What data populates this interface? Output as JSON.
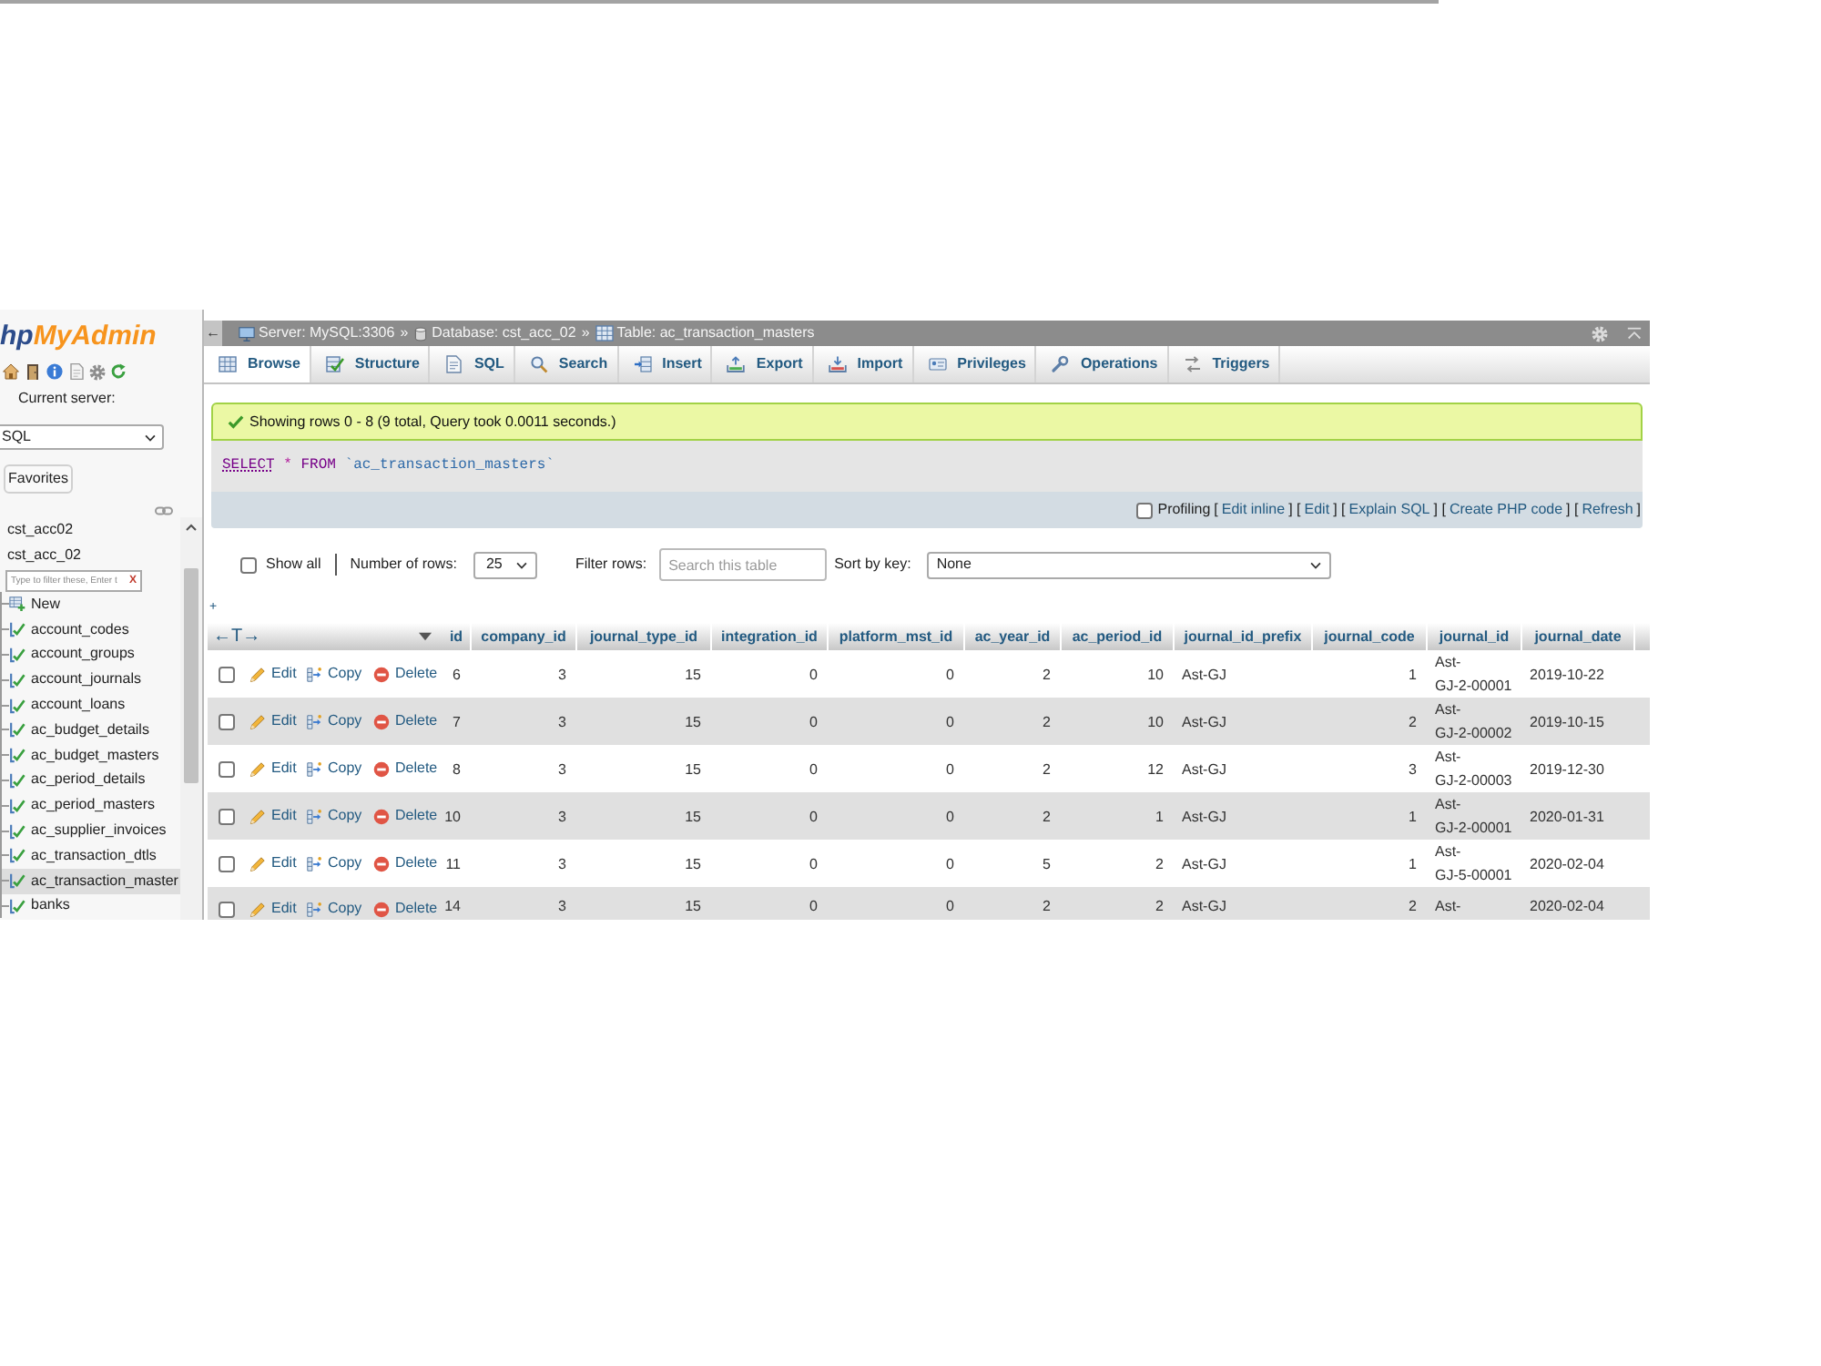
{
  "sidebar": {
    "logo": {
      "prefix": "hp",
      "name": "MyAdmin"
    },
    "current_server_label": "Current server:",
    "server_select": {
      "value": "SQL"
    },
    "favorites_button": "Favorites",
    "databases": [
      {
        "name": "cst_acc02",
        "selected": false
      },
      {
        "name": "cst_acc_02",
        "selected": false,
        "filter": {
          "placeholder": "Type to filter these, Enter t",
          "clear": "X"
        },
        "children": [
          {
            "kind": "new",
            "name": "New",
            "selected": false
          },
          {
            "kind": "table",
            "name": "account_codes",
            "selected": false
          },
          {
            "kind": "table",
            "name": "account_groups",
            "selected": false
          },
          {
            "kind": "table",
            "name": "account_journals",
            "selected": false
          },
          {
            "kind": "table",
            "name": "account_loans",
            "selected": false
          },
          {
            "kind": "table",
            "name": "ac_budget_details",
            "selected": false
          },
          {
            "kind": "table",
            "name": "ac_budget_masters",
            "selected": false
          },
          {
            "kind": "table",
            "name": "ac_period_details",
            "selected": false
          },
          {
            "kind": "table",
            "name": "ac_period_masters",
            "selected": false
          },
          {
            "kind": "table",
            "name": "ac_supplier_invoices",
            "selected": false
          },
          {
            "kind": "table",
            "name": "ac_transaction_dtls",
            "selected": false
          },
          {
            "kind": "table",
            "name": "ac_transaction_master",
            "selected": true
          },
          {
            "kind": "table",
            "name": "banks",
            "selected": false
          }
        ]
      }
    ]
  },
  "breadcrumb": {
    "back": "←",
    "items": [
      {
        "kind": "server",
        "label": "Server: MySQL:3306"
      },
      {
        "kind": "database",
        "separator": "»",
        "label": "Database: cst_acc_02"
      },
      {
        "kind": "table",
        "separator": "»",
        "label": "Table: ac_transaction_masters"
      }
    ]
  },
  "tabs": [
    {
      "kind": "browse",
      "label": "Browse",
      "selected": true
    },
    {
      "kind": "structure",
      "label": "Structure",
      "selected": false
    },
    {
      "kind": "sql",
      "label": "SQL",
      "selected": false
    },
    {
      "kind": "search",
      "label": "Search",
      "selected": false
    },
    {
      "kind": "insert",
      "label": "Insert",
      "selected": false
    },
    {
      "kind": "export",
      "label": "Export",
      "selected": false
    },
    {
      "kind": "import",
      "label": "Import",
      "selected": false
    },
    {
      "kind": "privileges",
      "label": "Privileges",
      "selected": false
    },
    {
      "kind": "operations",
      "label": "Operations",
      "selected": false
    },
    {
      "kind": "triggers",
      "label": "Triggers",
      "selected": false
    }
  ],
  "message": {
    "text": "Showing rows 0 - 8 (9 total, Query took 0.0011 seconds.)"
  },
  "query": {
    "tokens": [
      {
        "kind": "keyword_link",
        "text": "SELECT"
      },
      {
        "kind": "operator",
        "text": "*"
      },
      {
        "kind": "keyword",
        "text": "FROM"
      },
      {
        "kind": "identifier",
        "text": "`ac_transaction_masters`"
      }
    ]
  },
  "query_tools": {
    "profiling": {
      "label": "Profiling",
      "checked": false
    },
    "actions": [
      {
        "open": "[",
        "label": "Edit inline",
        "close": "]"
      },
      {
        "open": "[",
        "label": "Edit",
        "close": "]"
      },
      {
        "open": "[",
        "label": "Explain SQL",
        "close": "]"
      },
      {
        "open": "[",
        "label": "Create PHP code",
        "close": "]"
      },
      {
        "open": "[",
        "label": "Refresh",
        "close": "]"
      }
    ]
  },
  "navigation": {
    "show_all": {
      "label": "Show all",
      "checked": false
    },
    "rows_label": "Number of rows:",
    "rows_select": {
      "value": "25"
    },
    "filter_label": "Filter rows:",
    "filter": {
      "placeholder": "Search this table"
    },
    "sort_label": "Sort by key:",
    "sort_select": {
      "value": "None"
    }
  },
  "table": {
    "options_toggle": "+",
    "text_toggle": "←T→",
    "columns": [
      {
        "label": "id",
        "kind": "number"
      },
      {
        "label": "company_id",
        "kind": "number"
      },
      {
        "label": "journal_type_id",
        "kind": "number"
      },
      {
        "label": "integration_id",
        "kind": "number"
      },
      {
        "label": "platform_mst_id",
        "kind": "number"
      },
      {
        "label": "ac_year_id",
        "kind": "number"
      },
      {
        "label": "ac_period_id",
        "kind": "number"
      },
      {
        "label": "journal_id_prefix",
        "kind": "text"
      },
      {
        "label": "journal_code",
        "kind": "number"
      },
      {
        "label": "journal_id",
        "kind": "text"
      },
      {
        "label": "journal_date",
        "kind": "text"
      }
    ],
    "rows": [
      {
        "checked": false,
        "actions": [
          {
            "kind": "edit",
            "label": "Edit"
          },
          {
            "kind": "copy",
            "label": "Copy"
          },
          {
            "kind": "delete",
            "label": "Delete"
          }
        ],
        "cells": [
          "6",
          "3",
          "15",
          "0",
          "0",
          "2",
          "10",
          "Ast-GJ",
          "1",
          "Ast-GJ-2-00001",
          "2019-10-22"
        ]
      },
      {
        "checked": false,
        "actions": [
          {
            "kind": "edit",
            "label": "Edit"
          },
          {
            "kind": "copy",
            "label": "Copy"
          },
          {
            "kind": "delete",
            "label": "Delete"
          }
        ],
        "cells": [
          "7",
          "3",
          "15",
          "0",
          "0",
          "2",
          "10",
          "Ast-GJ",
          "2",
          "Ast-GJ-2-00002",
          "2019-10-15"
        ]
      },
      {
        "checked": false,
        "actions": [
          {
            "kind": "edit",
            "label": "Edit"
          },
          {
            "kind": "copy",
            "label": "Copy"
          },
          {
            "kind": "delete",
            "label": "Delete"
          }
        ],
        "cells": [
          "8",
          "3",
          "15",
          "0",
          "0",
          "2",
          "12",
          "Ast-GJ",
          "3",
          "Ast-GJ-2-00003",
          "2019-12-30"
        ]
      },
      {
        "checked": false,
        "actions": [
          {
            "kind": "edit",
            "label": "Edit"
          },
          {
            "kind": "copy",
            "label": "Copy"
          },
          {
            "kind": "delete",
            "label": "Delete"
          }
        ],
        "cells": [
          "10",
          "3",
          "15",
          "0",
          "0",
          "2",
          "1",
          "Ast-GJ",
          "1",
          "Ast-GJ-2-00001",
          "2020-01-31"
        ]
      },
      {
        "checked": false,
        "actions": [
          {
            "kind": "edit",
            "label": "Edit"
          },
          {
            "kind": "copy",
            "label": "Copy"
          },
          {
            "kind": "delete",
            "label": "Delete"
          }
        ],
        "cells": [
          "11",
          "3",
          "15",
          "0",
          "0",
          "5",
          "2",
          "Ast-GJ",
          "1",
          "Ast-GJ-5-00001",
          "2020-02-04"
        ]
      },
      {
        "checked": false,
        "actions": [
          {
            "kind": "edit",
            "label": "Edit"
          },
          {
            "kind": "copy",
            "label": "Copy"
          },
          {
            "kind": "delete",
            "label": "Delete"
          }
        ],
        "cells": [
          "14",
          "3",
          "15",
          "0",
          "0",
          "2",
          "2",
          "Ast-GJ",
          "2",
          "Ast-",
          "2020-02-04"
        ]
      }
    ]
  }
}
